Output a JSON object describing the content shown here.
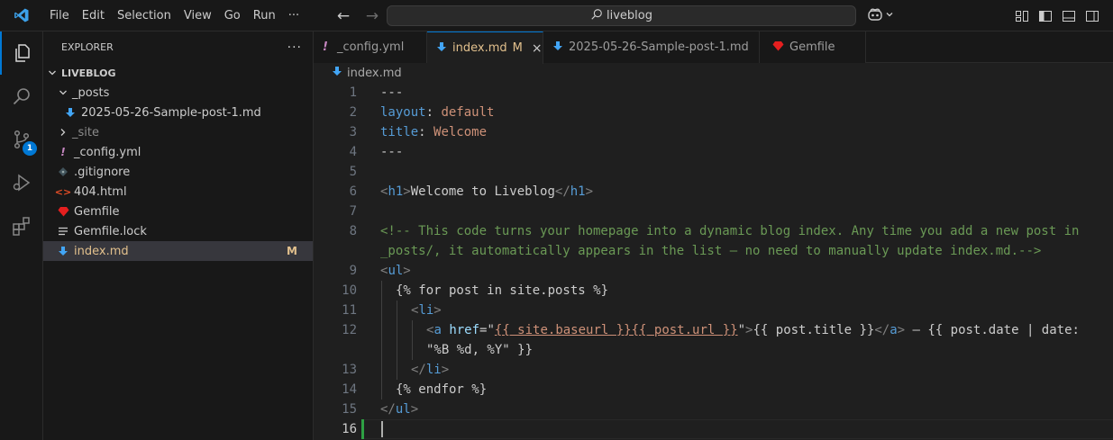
{
  "menu": [
    "File",
    "Edit",
    "Selection",
    "View",
    "Go",
    "Run",
    "···"
  ],
  "command_center": {
    "label": "liveblog"
  },
  "activity": {
    "scm_badge": "1"
  },
  "sidebar": {
    "title": "EXPLORER",
    "more": "···",
    "root": "LIVEBLOG",
    "items": [
      {
        "label": "_posts",
        "type": "folder-open"
      },
      {
        "label": "2025-05-26-Sample-post-1.md",
        "type": "md"
      },
      {
        "label": "_site",
        "type": "folder-closed"
      },
      {
        "label": "_config.yml",
        "type": "yml"
      },
      {
        "label": ".gitignore",
        "type": "git"
      },
      {
        "label": "404.html",
        "type": "html"
      },
      {
        "label": "Gemfile",
        "type": "ruby"
      },
      {
        "label": "Gemfile.lock",
        "type": "lock"
      },
      {
        "label": "index.md",
        "type": "md",
        "status": "M"
      }
    ]
  },
  "tabs": [
    {
      "label": "_config.yml"
    },
    {
      "label": "index.md",
      "status": "M",
      "close": "×"
    },
    {
      "label": "2025-05-26-Sample-post-1.md"
    },
    {
      "label": "Gemfile"
    }
  ],
  "breadcrumb": "index.md",
  "code": {
    "line_numbers": [
      "1",
      "2",
      "3",
      "4",
      "5",
      "6",
      "7",
      "8",
      "9",
      "10",
      "11",
      "12",
      "13",
      "14",
      "15",
      "16"
    ],
    "l1": "---",
    "l2_key": "layout",
    "l2_sep": ": ",
    "l2_val": "default",
    "l3_key": "title",
    "l3_sep": ": ",
    "l3_val": "Welcome",
    "l4": "---",
    "l6_open": "h1",
    "l6_text": "Welcome to Liveblog",
    "l6_close": "h1",
    "l8a": "<!-- This code turns your homepage into a dynamic blog index. Any time you add a new post in",
    "l8b": "_posts/, it automatically appears in the list — no need to manually update index.md.-->",
    "l9_tag": "ul",
    "l10": "{% for post in site.posts %}",
    "l11_tag": "li",
    "l12_tag": "a",
    "l12_attr": "href",
    "l12_eq": "=\"",
    "l12_url": "{{ site.baseurl }}{{ post.url }}",
    "l12_q": "\"",
    "l12_text": "{{ post.title }}",
    "l12_rest": " — {{ post.date | date:",
    "l12b": "\"%B %d, %Y\" }}",
    "l13_tag": "li",
    "l14": "{% endfor %}",
    "l15_tag": "ul"
  },
  "colors": {
    "accent": "#0078d4",
    "modified": "#e2c08d",
    "comment": "#6a9955"
  }
}
